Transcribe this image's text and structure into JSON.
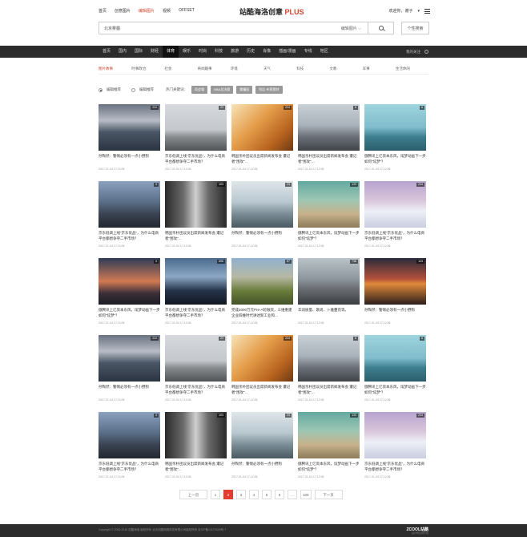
{
  "topnav": [
    {
      "label": "首页",
      "active": false
    },
    {
      "label": "创意图片",
      "active": false
    },
    {
      "label": "编辑图片",
      "active": true
    },
    {
      "label": "视频",
      "active": false
    },
    {
      "label": "OFFSET",
      "active": false
    }
  ],
  "logo": {
    "main": "站酷海洛创意",
    "plus": "PLUS"
  },
  "user": {
    "greeting": "欢迎你，谢子"
  },
  "search": {
    "value": "北京雾霾",
    "scope": "编辑图片",
    "custom_label": "个性搜索"
  },
  "channels": [
    "首页",
    "国内",
    "国际",
    "财经",
    "体育",
    "娱乐",
    "时尚",
    "科技",
    "旅游",
    "历史",
    "肖像",
    "插画/漫画",
    "专线",
    "地区"
  ],
  "active_channel": "体育",
  "my_follow": "我的关注",
  "subnav": [
    "图片故事",
    "时事政治",
    "社会",
    "奇闻趣事",
    "环境",
    "天气",
    "科技",
    "文教",
    "军事",
    "生活休闲"
  ],
  "active_subnav": "图片故事",
  "filter": {
    "option1": "编辑推荐",
    "option2": "编辑推荐",
    "hot_label": "热门关键词：",
    "tags": [
      "両会場",
      "NBA总决赛",
      "雾霾园",
      "科比·布莱恩特"
    ]
  },
  "cards": [
    {
      "count": "224",
      "title": "孙陶然：警惕必须有一点小野狗",
      "date": "2017-01-04 17:12:06",
      "img": "t1"
    },
    {
      "count": "23",
      "title": "京东低调上线“京东优品”，为什么电商平台都想争夺二手市场？",
      "date": "2017-01-04 17:12:06",
      "img": "t2"
    },
    {
      "count": "224",
      "title": "韩国亲朴团议员出席新闻发布会 遭记者“围攻”…",
      "date": "2017-01-04 17:12:06",
      "img": "t3"
    },
    {
      "count": "6",
      "title": "韩国亲朴团议员出席新闻发布会 遭记者“围攻”…",
      "date": "2017-01-04 17:12:06",
      "img": "t4"
    },
    {
      "count": "6",
      "title": "傲腾讯上亿资本东风，炫梦动画下一步如何“炫梦”？",
      "date": "2017-01-04 17:12:06",
      "img": "t5"
    },
    {
      "count": "3",
      "title": "京东低调上线“京东优品”，为什么电商平台都想争夺二手市场？",
      "date": "2017-01-04 17:12:06",
      "img": "t6"
    },
    {
      "count": "103",
      "title": "韩国亲朴团议员出席新闻发布会 遭记者“围攻”…",
      "date": "2017-01-04 17:12:06",
      "img": "t7"
    },
    {
      "count": "23",
      "title": "孙陶然：警惕必须有一点小野狗",
      "date": "2017-01-04 17:12:06",
      "img": "t8"
    },
    {
      "count": "123",
      "title": "傲腾讯上亿资本东风，炫梦动画下一步如何“炫梦”？",
      "date": "2017-01-04 17:12:06",
      "img": "t9"
    },
    {
      "count": "224",
      "title": "京东低调上线“京东优品”，为什么电商平台都想争夺二手市场？",
      "date": "2017-01-04 17:12:06",
      "img": "t10"
    },
    {
      "count": "3",
      "title": "傲腾讯上亿资本东风，炫梦动画下一步如何“炫梦”？",
      "date": "2017-01-04 17:12:06",
      "img": "t11"
    },
    {
      "count": "656",
      "title": "京东低调上线“京东优品”，为什么电商平台都想争夺二手市场？",
      "date": "2017-01-04 17:12:06",
      "img": "t12"
    },
    {
      "count": "87",
      "title": "完成4000万元Pre-A轮融资，三维重建企业四维时代讲述新工业和…",
      "date": "2017-01-04 17:12:06",
      "img": "t13"
    },
    {
      "count": "736",
      "title": "华润质量、歌尚、卜雅蔓花等。",
      "date": "2017-01-04 17:12:06",
      "img": "t14"
    },
    {
      "count": "123",
      "title": "孙陶然：警惕必须有一点小野狗",
      "date": "2017-01-04 17:12:06",
      "img": "t15"
    },
    {
      "count": "224",
      "title": "孙陶然：警惕必须有一点小野狗",
      "date": "2017-01-04 17:12:06",
      "img": "t1"
    },
    {
      "count": "23",
      "title": "京东低调上线“京东优品”，为什么电商平台都想争夺二手市场？",
      "date": "2017-01-04 17:12:06",
      "img": "t2"
    },
    {
      "count": "224",
      "title": "韩国亲朴团议员出席新闻发布会 遭记者“围攻”…",
      "date": "2017-01-04 17:12:06",
      "img": "t3"
    },
    {
      "count": "6",
      "title": "韩国亲朴团议员出席新闻发布会 遭记者“围攻”…",
      "date": "2017-01-04 17:12:06",
      "img": "t4"
    },
    {
      "count": "6",
      "title": "傲腾讯上亿资本东风，炫梦动画下一步如何“炫梦”？",
      "date": "2017-01-04 17:12:06",
      "img": "t5"
    },
    {
      "count": "3",
      "title": "京东低调上线“京东优品”，为什么电商平台都想争夺二手市场？",
      "date": "2017-01-04 17:12:06",
      "img": "t6"
    },
    {
      "count": "103",
      "title": "韩国亲朴团议员出席新闻发布会 遭记者“围攻”…",
      "date": "2017-01-04 17:12:06",
      "img": "t7"
    },
    {
      "count": "23",
      "title": "孙陶然：警惕必须有一点小野狗",
      "date": "2017-01-04 17:12:06",
      "img": "t8"
    },
    {
      "count": "123",
      "title": "傲腾讯上亿资本东风，炫梦动画下一步如何“炫梦”？",
      "date": "2017-01-04 17:12:06",
      "img": "t9"
    },
    {
      "count": "224",
      "title": "京东低调上线“京东优品”，为什么电商平台都想争夺二手市场？",
      "date": "2017-01-04 17:12:06",
      "img": "t10"
    }
  ],
  "pager": {
    "prev": "上一页",
    "pages": [
      "1",
      "2",
      "3",
      "4",
      "5",
      "6",
      "...",
      "100"
    ],
    "active": "2",
    "next": "下一页"
  },
  "footer": {
    "copy": "Copyright © 2006-2016 站酷海洛 版权所有   北京站酷网络科技有限公司版权所有 京ICP备13179339号-7",
    "logo": "ZCOOL站酷",
    "sub": "设计师互动平台"
  }
}
